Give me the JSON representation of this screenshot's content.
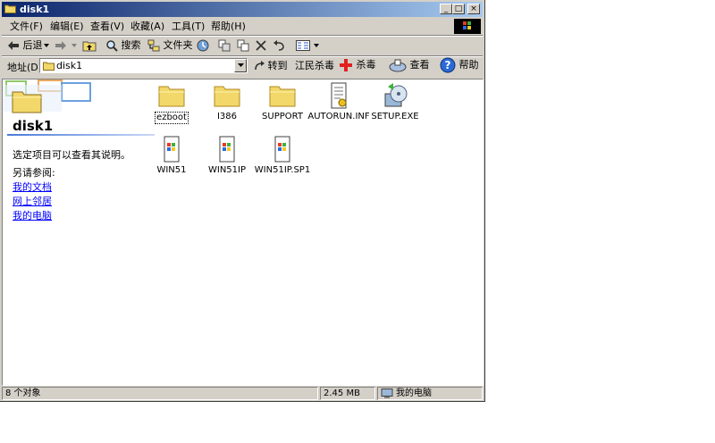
{
  "window": {
    "title": "disk1",
    "min_glyph": "_",
    "max_glyph": "□",
    "close_glyph": "×"
  },
  "menu": [
    "文件(F)",
    "编辑(E)",
    "查看(V)",
    "收藏(A)",
    "工具(T)",
    "帮助(H)"
  ],
  "toolbar": {
    "back_label": "后退",
    "search_label": "搜索",
    "folders_label": "文件夹"
  },
  "addressbar": {
    "label": "地址(D)",
    "value": "disk1",
    "go_label": "转到",
    "jiangmin_label": "江民杀毒",
    "antivirus_label": "杀毒",
    "scan_label": "查看",
    "help_label": "帮助"
  },
  "panel": {
    "title": "disk1",
    "description": "选定项目可以查看其说明。",
    "see_also": "另请参阅:",
    "links": [
      "我的文档",
      "网上邻居",
      "我的电脑"
    ]
  },
  "files": [
    {
      "name": "ezboot",
      "icon": "folder-icon"
    },
    {
      "name": "I386",
      "icon": "folder-icon"
    },
    {
      "name": "SUPPORT",
      "icon": "folder-icon"
    },
    {
      "name": "AUTORUN.INF",
      "icon": "inf-file-icon"
    },
    {
      "name": "SETUP.EXE",
      "icon": "setup-exe-icon"
    },
    {
      "name": "WIN51",
      "icon": "system-file-icon"
    },
    {
      "name": "WIN51IP",
      "icon": "system-file-icon"
    },
    {
      "name": "WIN51IP.SP1",
      "icon": "system-file-icon"
    }
  ],
  "status": {
    "count": "8 个对象",
    "size": "2.45 MB",
    "location": "我的电脑"
  },
  "colors": {
    "title_start": "#0a246a",
    "title_end": "#a6caf0",
    "face": "#d4d0c8",
    "link": "#0000ff",
    "folder": "#f2d86a"
  }
}
